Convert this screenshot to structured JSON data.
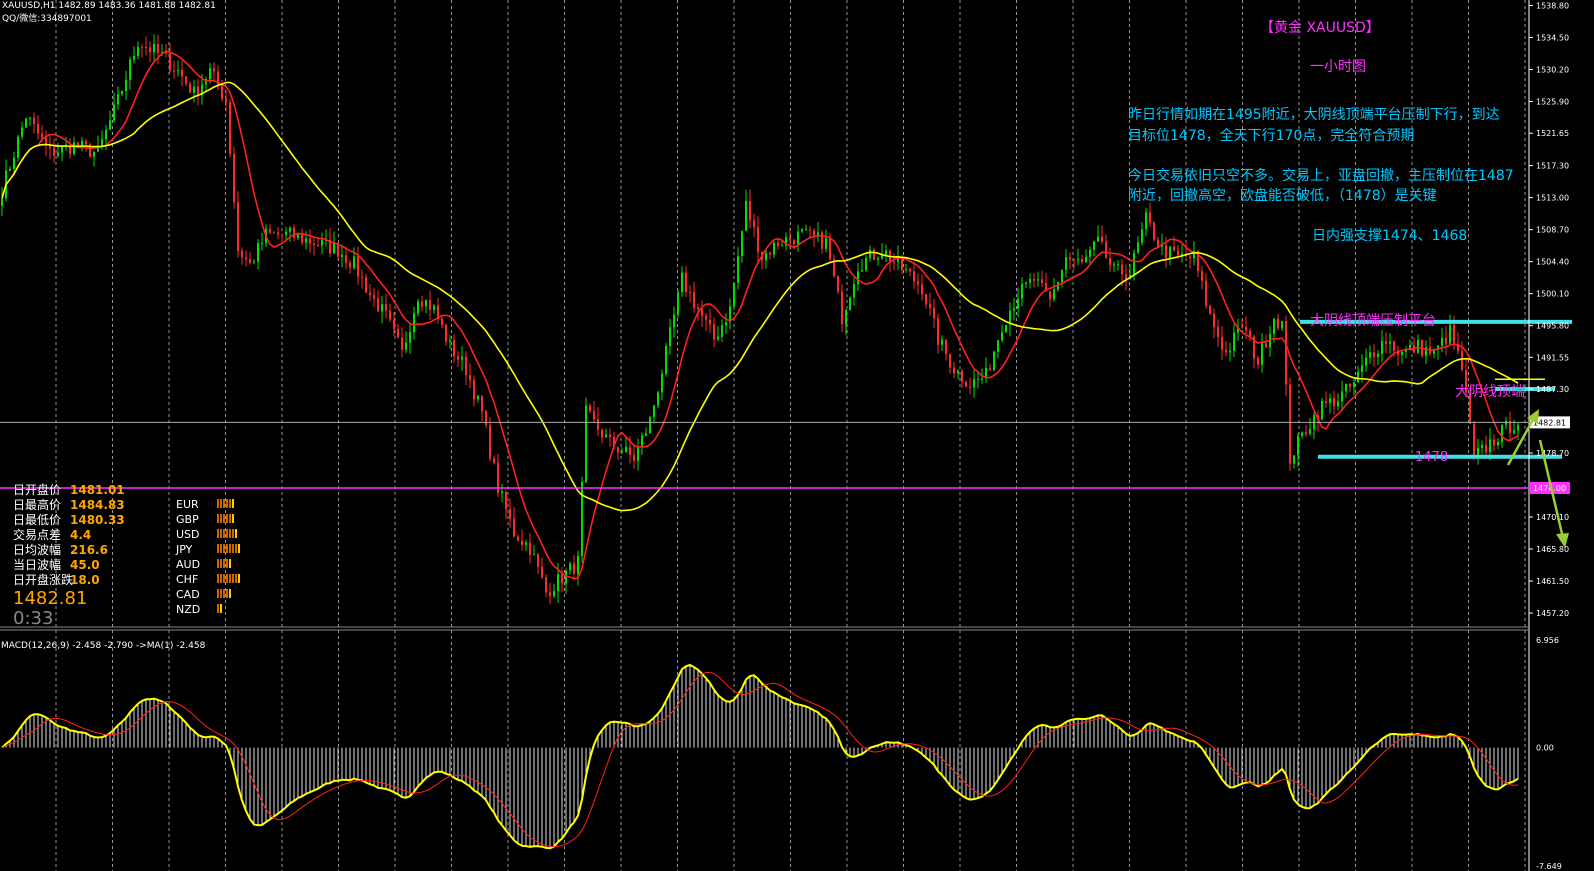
{
  "header": {
    "symbol_line": "XAUUSD,H1  1482.89 1483.36 1481.88 1482.81",
    "qq_line": "QQ/微信:334897001"
  },
  "annotations": {
    "title": "【黄金 XAUUSD】",
    "subtitle": "一小时图",
    "para1_line1": "昨日行情如期在1495附近，大阴线顶端平台压制下行，到达",
    "para1_line2": "目标位1478，全天下行170点，完全符合预期",
    "para2_line1": "今日交易依旧只空不多。交易上，亚盘回撤，主压制位在1487",
    "para2_line2": "附近，回撤高空，欧盘能否破低，（1478）是关键",
    "support": "日内强支撑1474、1468",
    "platform_label": "大阴线顶端压制平台",
    "top_label": "大阴线顶端",
    "level_label": "1478"
  },
  "stats_panel": {
    "rows": [
      {
        "label": "日开盘价",
        "value": "1481.01"
      },
      {
        "label": "日最高价",
        "value": "1484.83"
      },
      {
        "label": "日最低价",
        "value": "1480.33"
      },
      {
        "label": "交易点差",
        "value": "4.4"
      },
      {
        "label": "日均波幅",
        "value": "216.6"
      },
      {
        "label": "当日波幅",
        "value": "45.0"
      },
      {
        "label": "日开盘涨跌",
        "value": "18.0"
      }
    ],
    "big_price": "1482.81",
    "timer": "0:33",
    "currencies": [
      "EUR",
      "GBP",
      "USD",
      "JPY",
      "AUD",
      "CHF",
      "CAD",
      "NZD"
    ],
    "currency_bars": [
      6,
      6,
      7,
      8,
      5,
      8,
      5,
      2
    ],
    "colors": {
      "label": "#ffffff",
      "value": "#ffa500",
      "price": "#ffa500",
      "timer": "#888888",
      "bar": "#cc6600"
    }
  },
  "chart_data": {
    "type": "candlestick",
    "symbol": "XAUUSD",
    "timeframe": "H1",
    "price_axis": {
      "ylim": [
        1456.0,
        1539.0
      ],
      "ticks": [
        "1538.80",
        "1534.50",
        "1530.20",
        "1525.90",
        "1521.65",
        "1517.30",
        "1513.00",
        "1508.70",
        "1504.40",
        "1500.10",
        "1495.80",
        "1491.55",
        "1487.30",
        "1478.70",
        "1470.10",
        "1465.80",
        "1461.50",
        "1457.20"
      ],
      "current_price": "1482.81",
      "support_price": "1474.00"
    },
    "anchors": [
      [
        0,
        1514
      ],
      [
        6,
        1524
      ],
      [
        12,
        1519
      ],
      [
        18,
        1520
      ],
      [
        24,
        1519
      ],
      [
        29,
        1526
      ],
      [
        34,
        1534
      ],
      [
        40,
        1532
      ],
      [
        44,
        1530
      ],
      [
        48,
        1527
      ],
      [
        52,
        1530
      ],
      [
        56,
        1526
      ],
      [
        59,
        1506
      ],
      [
        62,
        1504
      ],
      [
        66,
        1508
      ],
      [
        72,
        1508
      ],
      [
        78,
        1507
      ],
      [
        84,
        1506
      ],
      [
        88,
        1504
      ],
      [
        92,
        1500
      ],
      [
        96,
        1497
      ],
      [
        100,
        1492
      ],
      [
        104,
        1500
      ],
      [
        108,
        1498
      ],
      [
        112,
        1493
      ],
      [
        116,
        1490
      ],
      [
        120,
        1484
      ],
      [
        124,
        1474
      ],
      [
        128,
        1468
      ],
      [
        132,
        1466
      ],
      [
        136,
        1460
      ],
      [
        140,
        1462
      ],
      [
        144,
        1464
      ],
      [
        146,
        1484
      ],
      [
        152,
        1480
      ],
      [
        158,
        1478
      ],
      [
        162,
        1483
      ],
      [
        166,
        1492
      ],
      [
        170,
        1502
      ],
      [
        174,
        1498
      ],
      [
        178,
        1494
      ],
      [
        182,
        1498
      ],
      [
        186,
        1512
      ],
      [
        190,
        1505
      ],
      [
        194,
        1507
      ],
      [
        200,
        1508
      ],
      [
        206,
        1507
      ],
      [
        210,
        1497
      ],
      [
        214,
        1504
      ],
      [
        220,
        1506
      ],
      [
        226,
        1503
      ],
      [
        230,
        1501
      ],
      [
        234,
        1494
      ],
      [
        238,
        1490
      ],
      [
        242,
        1488
      ],
      [
        246,
        1489
      ],
      [
        250,
        1496
      ],
      [
        254,
        1500
      ],
      [
        258,
        1502
      ],
      [
        262,
        1499
      ],
      [
        266,
        1505
      ],
      [
        270,
        1504
      ],
      [
        274,
        1507
      ],
      [
        278,
        1503
      ],
      [
        282,
        1503
      ],
      [
        286,
        1510
      ],
      [
        290,
        1506
      ],
      [
        294,
        1505
      ],
      [
        298,
        1505
      ],
      [
        302,
        1497
      ],
      [
        306,
        1492
      ],
      [
        310,
        1496
      ],
      [
        314,
        1491
      ],
      [
        318,
        1497
      ],
      [
        320,
        1496
      ],
      [
        322,
        1478
      ],
      [
        326,
        1482
      ],
      [
        330,
        1485
      ],
      [
        334,
        1486
      ],
      [
        338,
        1488
      ],
      [
        342,
        1492
      ],
      [
        346,
        1494
      ],
      [
        350,
        1492
      ],
      [
        354,
        1493
      ],
      [
        358,
        1492
      ],
      [
        362,
        1495
      ],
      [
        365,
        1490
      ],
      [
        368,
        1478
      ],
      [
        372,
        1480
      ],
      [
        376,
        1482
      ],
      [
        379,
        1483
      ]
    ],
    "moving_averages": [
      {
        "period": "fast",
        "color": "#ff2020"
      },
      {
        "period": "slow",
        "color": "#ffff00"
      }
    ],
    "zones": [
      {
        "label": "大阴线顶端压制平台",
        "price": 1496.3,
        "color": "#40e0e8"
      },
      {
        "label": "大阴线顶端",
        "price": 1487.3,
        "color": "#40e0e8"
      },
      {
        "label": "1478",
        "price": 1478.2,
        "color": "#40e0e8"
      }
    ]
  },
  "macd": {
    "label": "MACD(12,26,9) -2.458 -2.790  ->MA(1) -2.458",
    "ticks": [
      "6.956",
      "0.00",
      "-7.649"
    ],
    "ylim": [
      -7.649,
      6.956
    ]
  },
  "colors": {
    "bull": "#00e000",
    "bear": "#ff2a2a",
    "grid": "#bbbbbb",
    "axis_text": "#ffffff",
    "annotation": "#00c8ff",
    "magenta": "#ff30ff",
    "arrow": "#9acd32"
  }
}
